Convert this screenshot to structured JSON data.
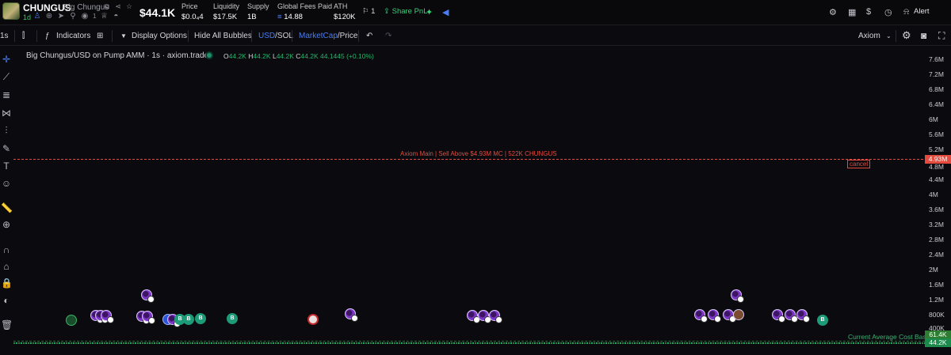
{
  "header": {
    "ticker": "CHUNGUS",
    "name": "Big Chungus",
    "age": "1d",
    "holders_count": "1",
    "big_price": "$44.1K",
    "stats": [
      {
        "label": "Price",
        "value": "$0.0₄4"
      },
      {
        "label": "Liquidity",
        "value": "$17.5K"
      },
      {
        "label": "Supply",
        "value": "1B"
      },
      {
        "label": "Global Fees Paid",
        "value": "14.88"
      },
      {
        "label": "ATH",
        "value": "$120K"
      }
    ],
    "watch_count": "1",
    "share_pnl": "Share PnL",
    "alert": "Alert"
  },
  "toolbar": {
    "interval": "1s",
    "indicators": "Indicators",
    "display_options": "Display Options",
    "hide_bubbles": "Hide All Bubbles",
    "usd": "USD",
    "sol": "/SOL",
    "marketcap": "MarketCap",
    "price": "/Price",
    "source": "Axiom"
  },
  "chart": {
    "title": "Big Chungus/USD on Pump AMM · 1s · axiom.trade",
    "ohlc": {
      "o_label": "O",
      "o": "44.2K",
      "h_label": "H",
      "h": "44.2K",
      "l_label": "L",
      "l": "44.2K",
      "c_label": "C",
      "c": "44.2K",
      "change": "44.1445 (+0.10%)"
    },
    "order_label": "Axiom Main | Sell Above $4.93M MC | 522K CHUNGUS",
    "cancel": "cancel",
    "cost_basis_label": "Current Average Cost Basis",
    "y_ticks": [
      "7.6M",
      "7.2M",
      "6.8M",
      "6.4M",
      "6M",
      "5.6M",
      "5.2M",
      "4.8M",
      "4.4M",
      "4M",
      "3.6M",
      "3.2M",
      "2.8M",
      "2.4M",
      "2M",
      "1.6M",
      "1.2M",
      "800K",
      "400K"
    ],
    "badges": {
      "order": "4.93M",
      "cost": "61.4K",
      "current": "44.2K"
    },
    "colors": {
      "order": "#e24b3e",
      "cost": "#2e7d32",
      "current": "#1b8a4a",
      "accent": "#4a7cf0"
    }
  }
}
